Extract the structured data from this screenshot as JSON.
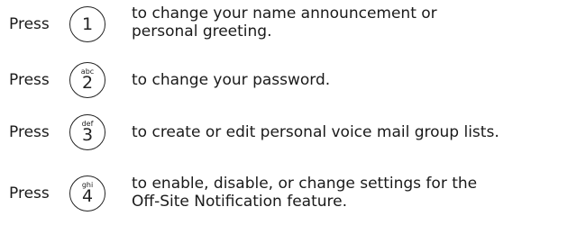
{
  "items": [
    {
      "press": "Press",
      "key_digit": "1",
      "key_letters": "",
      "lines": [
        "to change your name announcement or",
        "personal greeting."
      ]
    },
    {
      "press": "Press",
      "key_digit": "2",
      "key_letters": "abc",
      "lines": [
        "to change your password."
      ]
    },
    {
      "press": "Press",
      "key_digit": "3",
      "key_letters": "def",
      "lines": [
        "to create or edit personal voice mail group lists."
      ]
    },
    {
      "press": "Press",
      "key_digit": "4",
      "key_letters": "ghi",
      "lines": [
        "to enable, disable, or change settings for the",
        "Off-Site Notification feature."
      ]
    }
  ]
}
